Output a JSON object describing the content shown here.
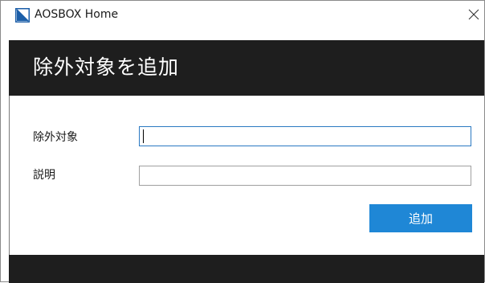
{
  "window": {
    "app_title": "AOSBOX Home",
    "app_icon": "aosbox-logo-icon",
    "close_icon": "close-icon",
    "accent_color": "#1f87d6",
    "header_color": "#1e1e1e"
  },
  "dialog": {
    "title": "除外対象を追加",
    "fields": [
      {
        "label": "除外対象",
        "value": "",
        "placeholder": ""
      },
      {
        "label": "説明",
        "value": "",
        "placeholder": ""
      }
    ],
    "add_button_label": "追加"
  }
}
